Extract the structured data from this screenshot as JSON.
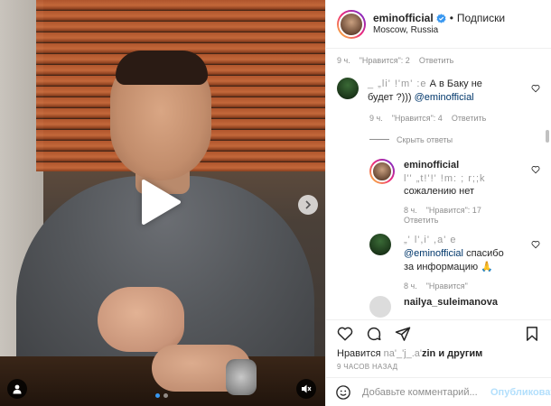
{
  "header": {
    "username": "eminofficial",
    "separator": "•",
    "follow_label": "Подписки",
    "location": "Moscow, Russia"
  },
  "comments": [
    {
      "kind": "meta",
      "time": "9 ч.",
      "likes": "\"Нравится\": 2",
      "reply": "Ответить"
    },
    {
      "kind": "comment",
      "user": "",
      "blurred": "_ „li' !'m' :e",
      "text": "А в Баку не будет ?)))",
      "mention": "@eminofficial",
      "time": "9 ч.",
      "likes": "\"Нравится\": 4",
      "reply": "Ответить"
    },
    {
      "kind": "hide",
      "label": "Скрыть ответы"
    },
    {
      "kind": "reply",
      "user": "eminofficial",
      "blurred": "l'' „t!'!' !m: ; r;;k",
      "text": "сожалению нет",
      "time": "8 ч.",
      "likes": "\"Нравится\": 17",
      "reply": "Ответить"
    },
    {
      "kind": "reply",
      "user": "",
      "blurred": "„' l',i' ,a' e",
      "mention": "@eminofficial",
      "text": "спасибо за информацию 🙏",
      "time": "8 ч.",
      "likes": "\"Нравится\"",
      "reply": ""
    },
    {
      "kind": "reply",
      "user": "nailya_suleimanova"
    }
  ],
  "likes_line": {
    "prefix": "Нравится",
    "blurred": "na'_'j_.a'",
    "name": "zin",
    "suffix": "и другим"
  },
  "timestamp": "9 ЧАСОВ НАЗАД",
  "add_comment": {
    "placeholder": "Добавьте комментарий...",
    "publish": "Опубликовать"
  },
  "icons": {
    "verified": "verified-badge-icon",
    "heart": "heart-icon",
    "comment": "comment-icon",
    "share": "share-icon",
    "save": "bookmark-icon",
    "emoji": "emoji-icon",
    "play": "play-icon",
    "next": "chevron-right-icon",
    "user_tag": "user-tag-icon",
    "mute": "speaker-muted-icon"
  },
  "colors": {
    "accent": "#3897f0",
    "mention": "#00376b",
    "publish_disabled": "#b2dffc",
    "meta_text": "#8e8e8e"
  },
  "carousel": {
    "count": 2,
    "active": 1
  }
}
